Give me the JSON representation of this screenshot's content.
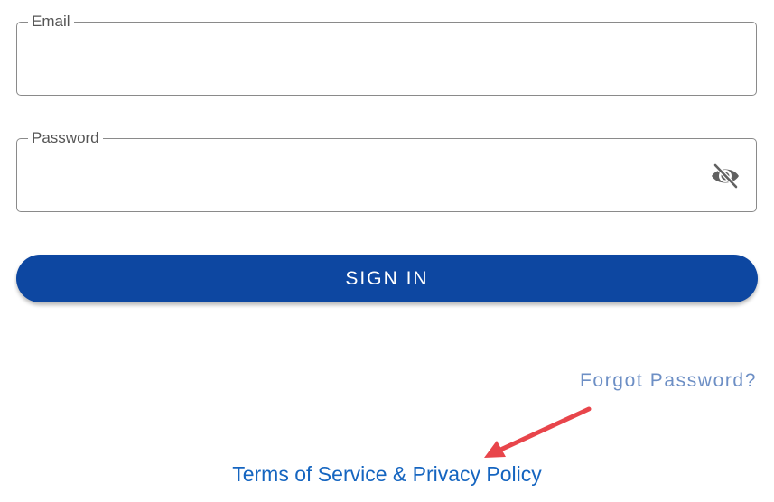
{
  "form": {
    "email": {
      "label": "Email",
      "value": ""
    },
    "password": {
      "label": "Password",
      "value": "",
      "visibility_icon": "eye-off-icon"
    },
    "signin_label": "SIGN IN",
    "forgot_label": "Forgot Password?",
    "terms_label": "Terms of Service & Privacy Policy"
  },
  "colors": {
    "primary": "#0d47a1",
    "link": "#1565c0",
    "link_muted": "#6d8fc5",
    "annotation_arrow": "#e8454b"
  }
}
